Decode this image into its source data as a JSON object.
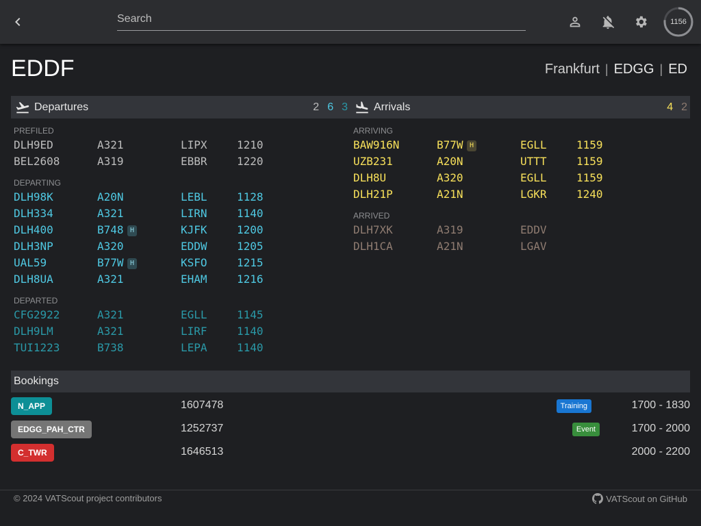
{
  "header": {
    "search_placeholder": "Search",
    "counter": "1156",
    "counter_progress": 0.77
  },
  "airport": {
    "icao": "EDDF",
    "city": "Frankfurt",
    "fir": "EDGG",
    "region": "ED",
    "separator": "|"
  },
  "departures": {
    "title": "Departures",
    "counts": [
      "2",
      "6",
      "3"
    ],
    "groups": {
      "prefiled": {
        "label": "PREFILED",
        "rows": [
          {
            "callsign": "DLH9ED",
            "type": "A321",
            "dest": "LIPX",
            "time": "1210",
            "heavy": ""
          },
          {
            "callsign": "BEL2608",
            "type": "A319",
            "dest": "EBBR",
            "time": "1220",
            "heavy": ""
          }
        ]
      },
      "departing": {
        "label": "DEPARTING",
        "rows": [
          {
            "callsign": "DLH98K",
            "type": "A20N",
            "dest": "LEBL",
            "time": "1128",
            "heavy": ""
          },
          {
            "callsign": "DLH334",
            "type": "A321",
            "dest": "LIRN",
            "time": "1140",
            "heavy": ""
          },
          {
            "callsign": "DLH400",
            "type": "B748",
            "dest": "KJFK",
            "time": "1200",
            "heavy": "H"
          },
          {
            "callsign": "DLH3NP",
            "type": "A320",
            "dest": "EDDW",
            "time": "1205",
            "heavy": ""
          },
          {
            "callsign": "UAL59",
            "type": "B77W",
            "dest": "KSFO",
            "time": "1215",
            "heavy": "H"
          },
          {
            "callsign": "DLH8UA",
            "type": "A321",
            "dest": "EHAM",
            "time": "1216",
            "heavy": ""
          }
        ]
      },
      "departed": {
        "label": "DEPARTED",
        "rows": [
          {
            "callsign": "CFG2922",
            "type": "A321",
            "dest": "EGLL",
            "time": "1145",
            "heavy": ""
          },
          {
            "callsign": "DLH9LM",
            "type": "A321",
            "dest": "LIRF",
            "time": "1140",
            "heavy": ""
          },
          {
            "callsign": "TUI1223",
            "type": "B738",
            "dest": "LEPA",
            "time": "1140",
            "heavy": ""
          }
        ]
      }
    }
  },
  "arrivals": {
    "title": "Arrivals",
    "counts": [
      "4",
      "2"
    ],
    "groups": {
      "arriving": {
        "label": "ARRIVING",
        "rows": [
          {
            "callsign": "BAW916N",
            "type": "B77W",
            "dest": "EGLL",
            "time": "1159",
            "heavy": "H"
          },
          {
            "callsign": "UZB231",
            "type": "A20N",
            "dest": "UTTT",
            "time": "1159",
            "heavy": ""
          },
          {
            "callsign": "DLH8U",
            "type": "A320",
            "dest": "EGLL",
            "time": "1159",
            "heavy": ""
          },
          {
            "callsign": "DLH21P",
            "type": "A21N",
            "dest": "LGKR",
            "time": "1240",
            "heavy": ""
          }
        ]
      },
      "arrived": {
        "label": "ARRIVED",
        "rows": [
          {
            "callsign": "DLH7XK",
            "type": "A319",
            "dest": "EDDV",
            "time": "",
            "heavy": ""
          },
          {
            "callsign": "DLH1CA",
            "type": "A21N",
            "dest": "LGAV",
            "time": "",
            "heavy": ""
          }
        ]
      }
    }
  },
  "bookings": {
    "title": "Bookings",
    "rows": [
      {
        "position": "N_APP",
        "cid": "1607478",
        "tag": "Training",
        "time": "1700 - 1830",
        "color": "#0d8f96",
        "tag_color": "#1976d2"
      },
      {
        "position": "EDGG_PAH_CTR",
        "cid": "1252737",
        "tag": "Event",
        "time": "1700 - 2000",
        "color": "#757575",
        "tag_color": "#388e3c"
      },
      {
        "position": "C_TWR",
        "cid": "1646513",
        "tag": "",
        "time": "2000 - 2200",
        "color": "#d32f2f",
        "tag_color": ""
      }
    ]
  },
  "footer": {
    "copyright": "© 2024 VATScout project contributors",
    "github": "VATScout on GitHub"
  },
  "colors": {
    "prefiled": "#bdbdbd",
    "departing": "#4fc9e3",
    "departed": "#2a99a8",
    "arriving": "#f7e05a",
    "arrived": "#8f7c71"
  }
}
